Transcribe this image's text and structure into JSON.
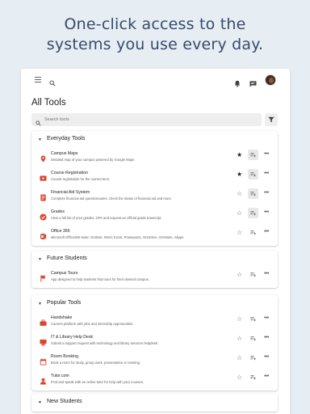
{
  "headline": {
    "line1": "One-click access to the",
    "line2": "systems you use every day."
  },
  "page_title": "All Tools",
  "search": {
    "placeholder": "Search tools",
    "value": ""
  },
  "colors": {
    "background": "#e6eef4",
    "headline": "#3a4a6b",
    "tool_icon_red": "#d9462f"
  },
  "sections": [
    {
      "title": "Everyday Tools",
      "tools": [
        {
          "name": "Campus Maps",
          "description": "Detailed map of your campus powered by Google Maps",
          "icon": "map-pin-icon",
          "starred": true,
          "list_active": true
        },
        {
          "name": "Course Registration",
          "description": "Course registration for the current term.",
          "icon": "video-play-icon",
          "starred": true,
          "list_active": true
        },
        {
          "name": "Financial Aid System",
          "description": "Complete financial aid questionnaires, check the status of financial aid and more.",
          "icon": "document-icon",
          "starred": false,
          "list_active": true
        },
        {
          "name": "Grades",
          "description": "View a full list of your grades, GPA and request an official grade transcript.",
          "icon": "checkmark-circle-icon",
          "starred": false,
          "list_active": true
        },
        {
          "name": "Office 365",
          "description": "Microsoft Office365 Suite: Outlook, Word, Excel, Powerpoint, OneDrive, OneNote, Skype",
          "icon": "office-icon",
          "starred": false,
          "list_active": false
        }
      ]
    },
    {
      "title": "Future Students",
      "tools": [
        {
          "name": "Campus Tours",
          "description": "App designed to help students find tours for their desired campus.",
          "icon": "flag-icon",
          "starred": false,
          "list_active": false
        }
      ]
    },
    {
      "title": "Popular Tools",
      "tools": [
        {
          "name": "Handshake",
          "description": "Careers platform with jobs and internship opportunities.",
          "icon": "briefcase-icon",
          "starred": false,
          "list_active": false
        },
        {
          "name": "IT & Library Help Desk",
          "description": "Submit a support request with technology and library services helpdesk.",
          "icon": "help-desk-icon",
          "starred": false,
          "list_active": false
        },
        {
          "name": "Room Booking",
          "description": "Book a room for study, group work, presentation or meeting.",
          "icon": "calendar-icon",
          "starred": false,
          "list_active": false
        },
        {
          "name": "Tutor.com",
          "description": "Find and speak with an online tutor for help with your courses.",
          "icon": "tutor-icon",
          "starred": false,
          "list_active": false
        }
      ]
    },
    {
      "title": "New Students",
      "tools": []
    }
  ]
}
